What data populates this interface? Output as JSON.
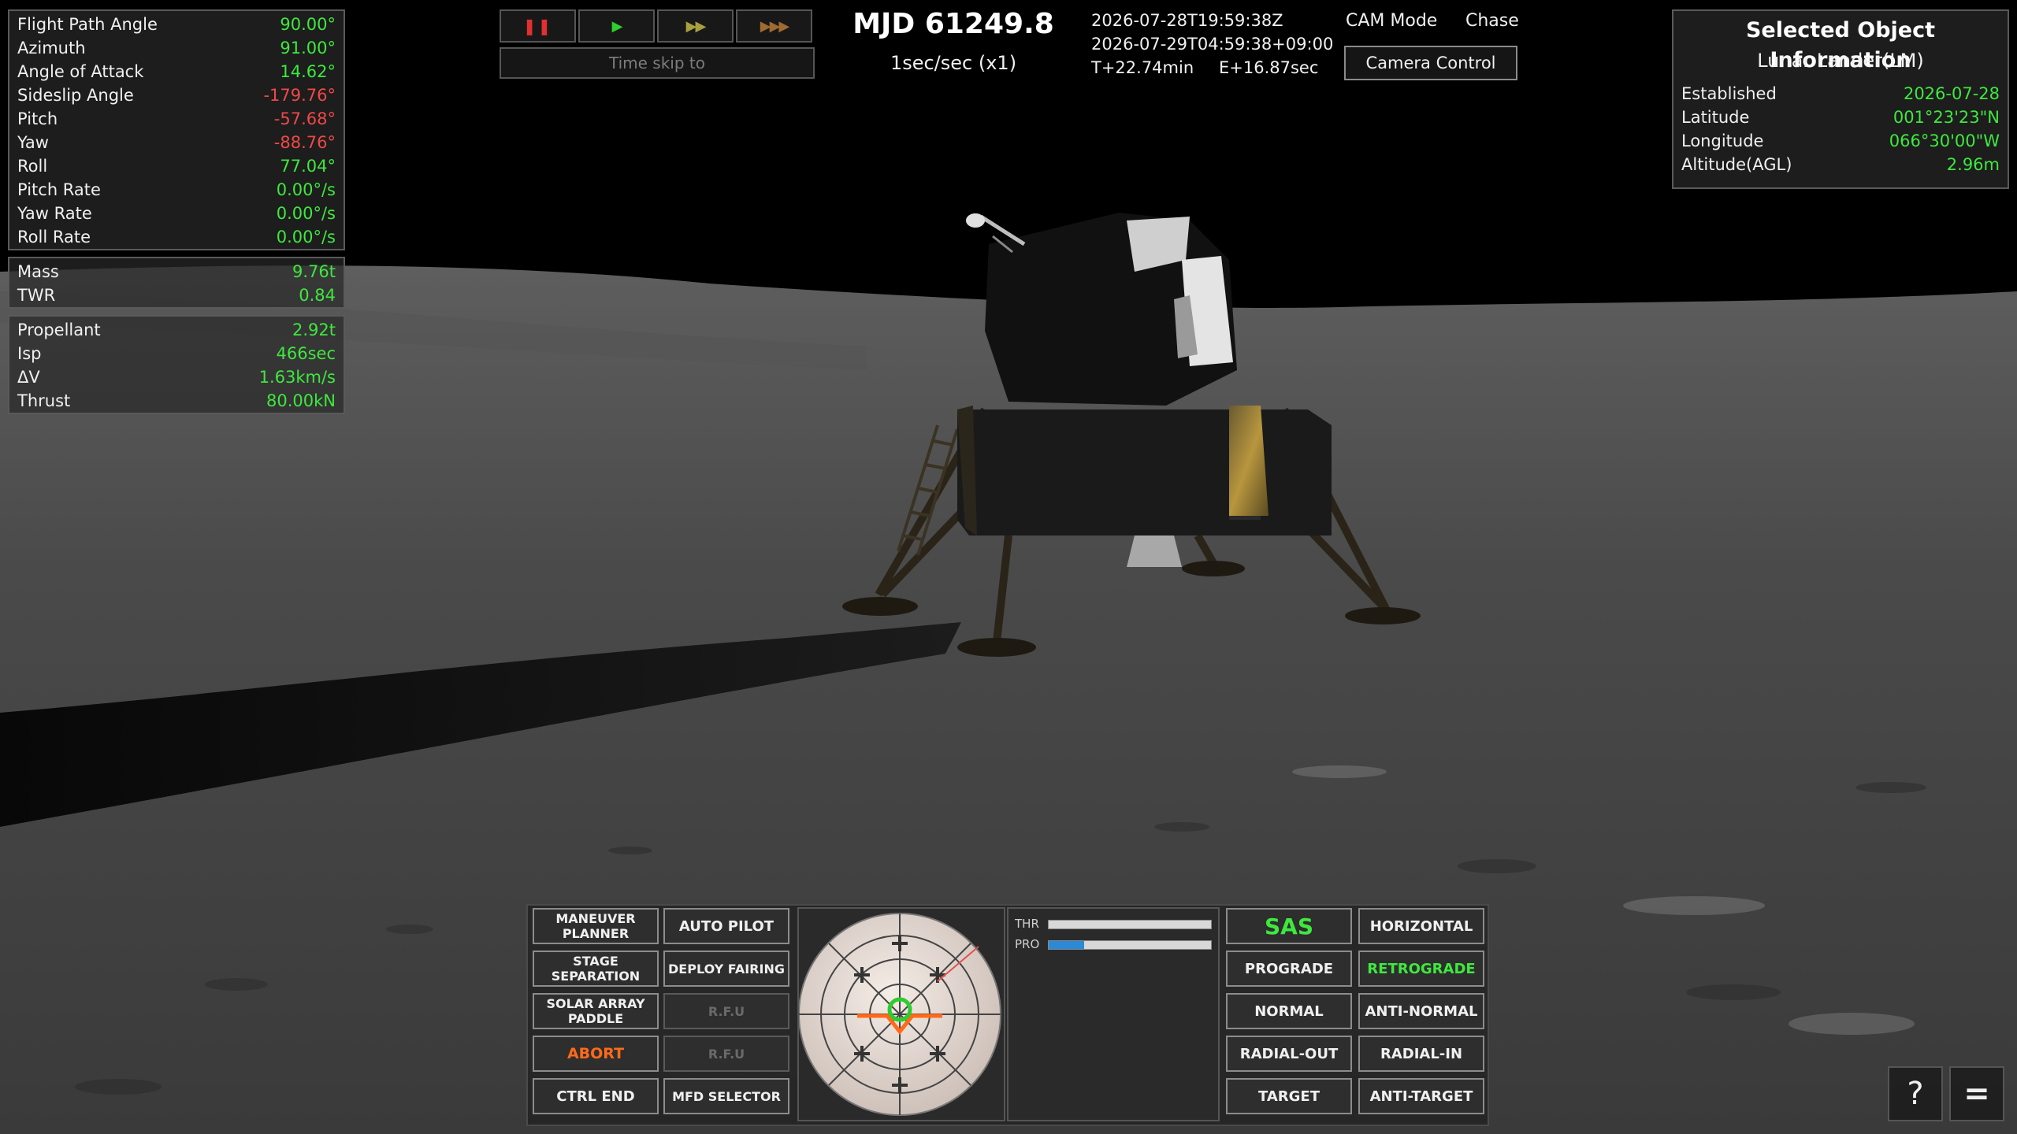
{
  "telemetry_attitude": [
    {
      "label": "Flight Path Angle",
      "value": "90.00°",
      "color": "green"
    },
    {
      "label": "Azimuth",
      "value": "91.00°",
      "color": "green"
    },
    {
      "label": "Angle of Attack",
      "value": "14.62°",
      "color": "green"
    },
    {
      "label": "Sideslip Angle",
      "value": "-179.76°",
      "color": "red"
    },
    {
      "label": "Pitch",
      "value": "-57.68°",
      "color": "red"
    },
    {
      "label": "Yaw",
      "value": "-88.76°",
      "color": "red"
    },
    {
      "label": "Roll",
      "value": "77.04°",
      "color": "green"
    },
    {
      "label": "Pitch Rate",
      "value": "0.00°/s",
      "color": "green"
    },
    {
      "label": "Yaw Rate",
      "value": "0.00°/s",
      "color": "green"
    },
    {
      "label": "Roll Rate",
      "value": "0.00°/s",
      "color": "green"
    }
  ],
  "telemetry_mass": [
    {
      "label": "Mass",
      "value": "9.76t",
      "color": "green"
    },
    {
      "label": "TWR",
      "value": "0.84",
      "color": "green"
    }
  ],
  "telemetry_engine": [
    {
      "label": "Propellant",
      "value": "2.92t",
      "color": "green"
    },
    {
      "label": "Isp",
      "value": "466sec",
      "color": "green"
    },
    {
      "label": "ΔV",
      "value": "1.63km/s",
      "color": "green"
    },
    {
      "label": "Thrust",
      "value": "80.00kN",
      "color": "green"
    }
  ],
  "info": {
    "title": "Selected Object Information",
    "object_name": "Lunar Lander(LM)",
    "rows": [
      {
        "label": "Established",
        "value": "2026-07-28"
      },
      {
        "label": "Latitude",
        "value": "001°23'23\"N"
      },
      {
        "label": "Longitude",
        "value": "066°30'00\"W"
      },
      {
        "label": "Altitude(AGL)",
        "value": "2.96m"
      }
    ]
  },
  "time": {
    "pause_glyph": "❚❚",
    "play_glyph": "▶",
    "ff2_glyph": "▶▶",
    "ff3_glyph": "▶▶▶",
    "time_skip_placeholder": "Time skip to",
    "mjd": "MJD 61249.8",
    "rate": "1sec/sec (x1)",
    "utc": "2026-07-28T19:59:38Z",
    "local": "2026-07-29T04:59:38+09:00",
    "t_plus": "T+22.74min",
    "e_plus": "E+16.87sec"
  },
  "camera": {
    "mode_label": "CAM Mode",
    "mode_value": "Chase",
    "control_label": "Camera Control"
  },
  "console": {
    "left_buttons": [
      {
        "label": "MANEUVER PLANNER"
      },
      {
        "label": "AUTO PILOT"
      },
      {
        "label": "STAGE SEPARATION"
      },
      {
        "label": "DEPLOY FAIRING"
      },
      {
        "label": "SOLAR ARRAY PADDLE"
      },
      {
        "label": "R.F.U"
      },
      {
        "label": "ABORT"
      },
      {
        "label": "R.F.U"
      },
      {
        "label": "CTRL END"
      },
      {
        "label": "MFD SELECTOR"
      }
    ],
    "right_buttons": [
      {
        "label": "SAS"
      },
      {
        "label": "HORIZONTAL"
      },
      {
        "label": "PROGRADE"
      },
      {
        "label": "RETROGRADE"
      },
      {
        "label": "NORMAL"
      },
      {
        "label": "ANTI-NORMAL"
      },
      {
        "label": "RADIAL-OUT"
      },
      {
        "label": "RADIAL-IN"
      },
      {
        "label": "TARGET"
      },
      {
        "label": "ANTI-TARGET"
      }
    ],
    "gauges": [
      {
        "label": "THR",
        "level": 1.0,
        "color": "#d8d8d8"
      },
      {
        "label": "PRO",
        "level": 0.22,
        "color": "#2a8ad8"
      }
    ]
  },
  "corner": {
    "help": "?",
    "menu": "="
  },
  "colors": {
    "value_green": "#3ee83e",
    "value_red": "#f04848",
    "abort_orange": "#ff6a1a",
    "gauge_blue": "#2a8ad8"
  }
}
